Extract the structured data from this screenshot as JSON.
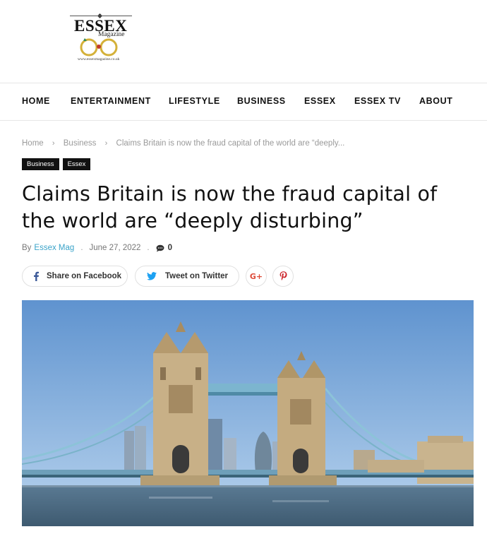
{
  "logo": {
    "word": "ESSEX",
    "sub": "Magazine",
    "url": "www.essexmagazine.co.uk"
  },
  "nav": {
    "items": [
      {
        "label": "HOME"
      },
      {
        "label": "ENTERTAINMENT"
      },
      {
        "label": "LIFESTYLE"
      },
      {
        "label": "BUSINESS"
      },
      {
        "label": "ESSEX"
      },
      {
        "label": "ESSEX TV"
      },
      {
        "label": "ABOUT"
      }
    ]
  },
  "breadcrumb": {
    "home": "Home",
    "section": "Business",
    "current": "Claims Britain is now the fraud capital of the world are “deeply..."
  },
  "tags": [
    {
      "label": "Business"
    },
    {
      "label": "Essex"
    }
  ],
  "article": {
    "title": "Claims Britain is now the fraud capital of the world are “deeply disturbing”",
    "by": "By",
    "author": "Essex Mag",
    "date": "June 27, 2022",
    "comments": "0"
  },
  "share": {
    "facebook_label": "Share on Facebook",
    "twitter_label": "Tweet on Twitter"
  },
  "colors": {
    "accent": "#3aa3c9",
    "facebook": "#3b5998",
    "twitter": "#1da1f2",
    "google": "#dd4b39",
    "pinterest": "#cb2027",
    "tag_bg": "#111111"
  }
}
